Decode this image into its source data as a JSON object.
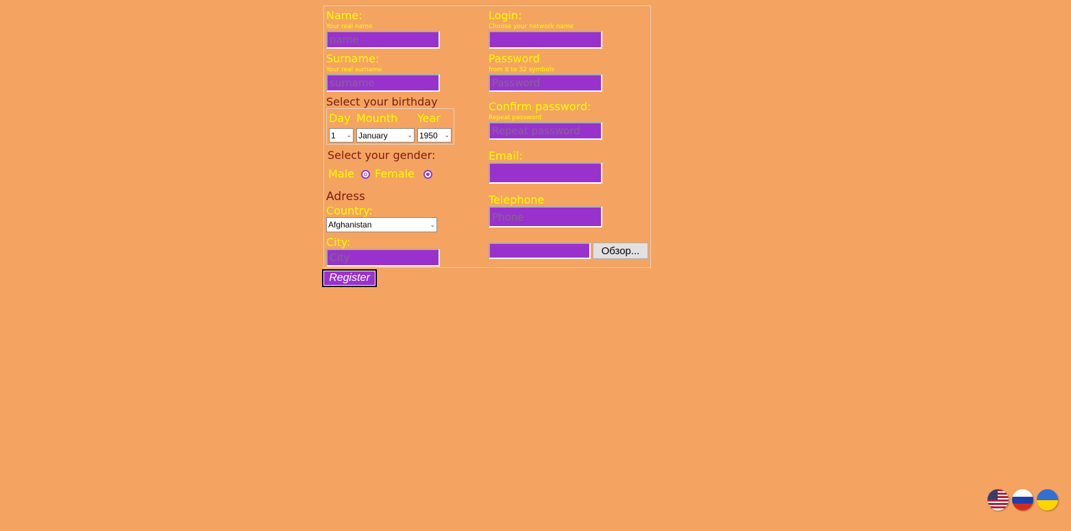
{
  "left": {
    "name_label": "Name:",
    "name_hint": "Your real name",
    "name_placeholder": "name",
    "surname_label": "Surname:",
    "surname_hint": "Your real surname",
    "surname_placeholder": "surname",
    "birthday_title": "Select your birthday",
    "day_label": "Day",
    "month_label": "Mounth",
    "year_label": "Year",
    "day_value": "1",
    "month_value": "January",
    "year_value": "1950",
    "gender_title": "Select your gender:",
    "male_label": "Male",
    "female_label": "Female",
    "address_title": "Adress",
    "country_label": "Country:",
    "country_value": "Afghanistan",
    "city_label": "City:",
    "city_placeholder": "City"
  },
  "right": {
    "login_label": "Login:",
    "login_hint": "Choose your network name",
    "password_label": "Password",
    "password_hint": "from 8 to 32 symbols",
    "password_placeholder": "Password",
    "confirm_label": "Confirm password:",
    "confirm_hint": "Repeat password",
    "confirm_placeholder": "Repeat password",
    "email_label": "Email:",
    "telephone_label": "Telephone",
    "telephone_placeholder": "Phone",
    "browse_label": "Обзор..."
  },
  "register_label": "Register",
  "languages": [
    "english-flag",
    "russian-flag",
    "ukrainian-flag"
  ],
  "colors": {
    "background": "#f4a460",
    "label": "#ffff00",
    "heading": "#7a1a14",
    "field": "#9932cc"
  }
}
